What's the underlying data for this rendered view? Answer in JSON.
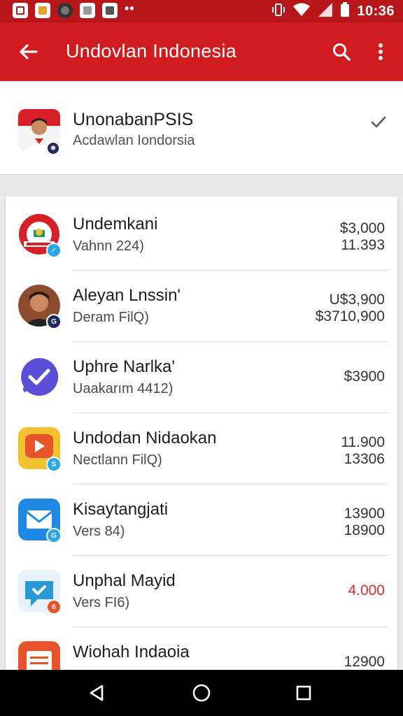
{
  "status_bar": {
    "time": "10:36",
    "icons": [
      "app-notification-icon",
      "app-notification-icon",
      "app-notification-icon",
      "app-notification-icon",
      "app-notification-icon",
      "vibrate-icon",
      "wifi-icon",
      "signal-icon",
      "battery-icon"
    ],
    "dots": "••"
  },
  "app_bar": {
    "title": "Undovlan Indonesia",
    "back_icon": "arrow-back-icon",
    "search_icon": "search-icon",
    "more_icon": "more-vert-icon"
  },
  "selected": {
    "name": "UnonabanPSIS",
    "subtitle": "Acdawlan Iondorsia",
    "check_icon": "check-icon"
  },
  "items": [
    {
      "name": "Undemkani",
      "sub": "Vahnn 224)",
      "value1": "$3,000",
      "value2": "11.393",
      "accent": "#d61f26",
      "badge_color": "#2aa7e6"
    },
    {
      "name": "Aleyan Lnssin'",
      "sub": "Deram FilQ)",
      "value1": "U$3,900",
      "value2": "$3710,900",
      "accent": "#8a4b2e",
      "badge_color": "#1f2a5c"
    },
    {
      "name": "Uphre Narlka'",
      "sub": "Uaakarım 4412)",
      "value1": "$3900",
      "value2": "",
      "accent": "#5b4fd8",
      "badge_color": ""
    },
    {
      "name": "Undodan Nidaokan",
      "sub": "Nectlann FilQ)",
      "value1": "11.900",
      "value2": "13306",
      "accent": "#f2c12e",
      "badge_color": "#2aa7e6"
    },
    {
      "name": "Kisaytangjati",
      "sub": "Vers 84)",
      "value1": "13900",
      "value2": "18900",
      "accent": "#1e88e5",
      "badge_color": "#2aa7e6"
    },
    {
      "name": "Unphal Mayid",
      "sub": "Vers FI6)",
      "value1": "4.000",
      "value2": "",
      "accent": "#2a9ad6",
      "badge_color": "#e8532a",
      "value_color": "#d32f2f"
    },
    {
      "name": "Wiohah Indaoia",
      "sub": "",
      "value1": "12900",
      "value2": "",
      "accent": "#e8532a",
      "badge_color": ""
    }
  ],
  "nav": {
    "back_icon": "nav-back-icon",
    "home_icon": "nav-home-icon",
    "recents_icon": "nav-recents-icon"
  }
}
